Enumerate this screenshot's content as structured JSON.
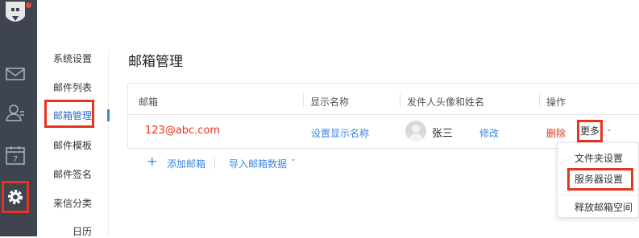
{
  "nav": {
    "items": [
      "系统设置",
      "邮件列表",
      "邮箱管理",
      "邮件模板",
      "邮件签名",
      "来信分类",
      "日历"
    ],
    "selected": "邮箱管理"
  },
  "page_title": "邮箱管理",
  "table": {
    "headers": [
      "邮箱",
      "显示名称",
      "发件人头像和姓名",
      "操作"
    ],
    "rows": [
      {
        "email": "123@abc.com",
        "display_name": "设置显示名称",
        "sender_name": "张三",
        "edit": "修改",
        "delete": "删除",
        "more": "更多"
      }
    ]
  },
  "actions": {
    "add": "添加邮箱",
    "import": "导入邮箱数据"
  },
  "more_menu": [
    "文件夹设置",
    "服务器设置",
    "释放邮箱空间"
  ],
  "icons": {
    "rail": [
      "logo-icon",
      "mail-icon",
      "contacts-icon",
      "calendar-icon",
      "settings-icon"
    ],
    "calendar_day": "7",
    "add": "plus-icon",
    "dropdown": "chevron-down-icon"
  },
  "colors": {
    "rail_bg": "#3e4450",
    "accent": "#3b86e0",
    "danger": "#e8331f",
    "notify_dot": "#f0473d"
  }
}
